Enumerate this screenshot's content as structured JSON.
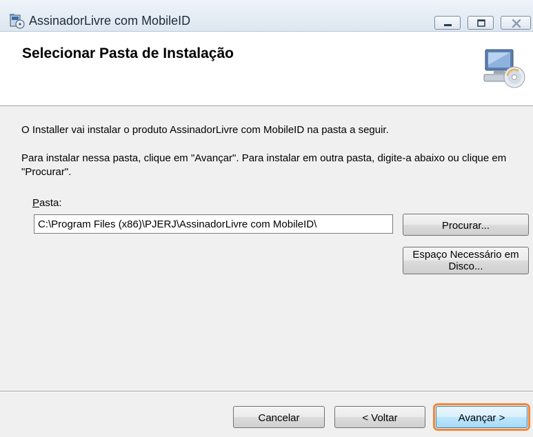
{
  "window": {
    "title": "AssinadorLivre com MobileID",
    "app_icon": "installer-package-icon",
    "controls": {
      "minimize": "minimize-icon",
      "maximize": "maximize-icon",
      "close": "close-icon"
    }
  },
  "header": {
    "title": "Selecionar Pasta de Instalação",
    "icon": "computer-cd-icon"
  },
  "body": {
    "intro": "O Installer vai instalar o produto AssinadorLivre com MobileID na pasta a seguir.",
    "instructions": "Para instalar nessa pasta, clique em \"Avançar\". Para instalar em outra pasta, digite-a abaixo ou clique em \"Procurar\"."
  },
  "folder": {
    "label_accel": "P",
    "label_rest": "asta:",
    "path_value": "C:\\Program Files (x86)\\PJERJ\\AssinadorLivre com MobileID\\"
  },
  "buttons": {
    "browse": {
      "accel": "",
      "label": "Procurar..."
    },
    "disk_cost_line1": "Espaço Necessário em",
    "disk_cost_line2": "Disco...",
    "cancel": "Cancelar",
    "back": "< Voltar",
    "next": "Avançar >"
  },
  "colors": {
    "highlight_outline": "#f0883a",
    "dialog_background": "#f0f0f0",
    "header_background": "#ffffff"
  }
}
